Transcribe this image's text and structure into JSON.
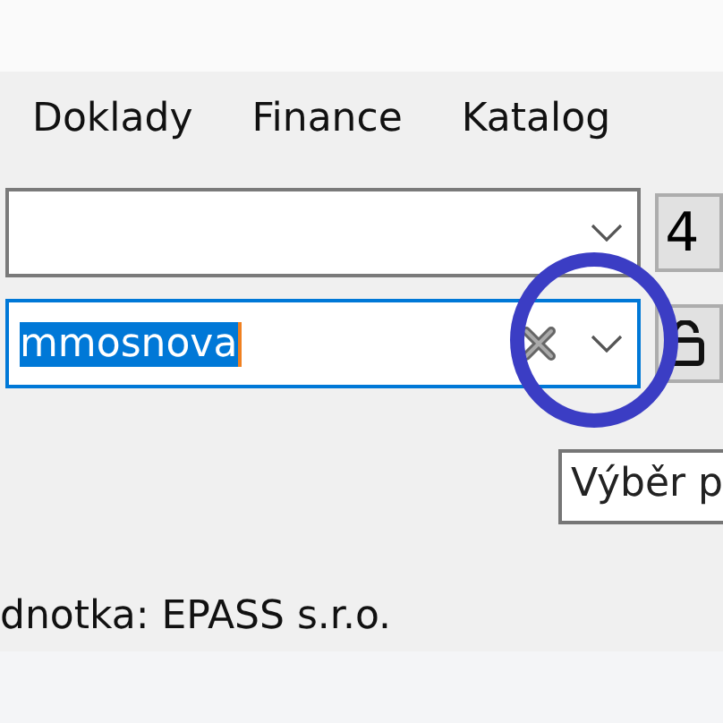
{
  "menu": [
    {
      "label": "Doklady"
    },
    {
      "label": "Finance"
    },
    {
      "label": "Katalog"
    }
  ],
  "fields": [
    {
      "focused": false,
      "clearable": false,
      "side_button": "4"
    },
    {
      "value": "mmosnova",
      "focused": true,
      "text_selected": true,
      "clearable": true
    }
  ],
  "tooltip": "Výběr p",
  "status": "dnotka: EPASS s.r.o."
}
